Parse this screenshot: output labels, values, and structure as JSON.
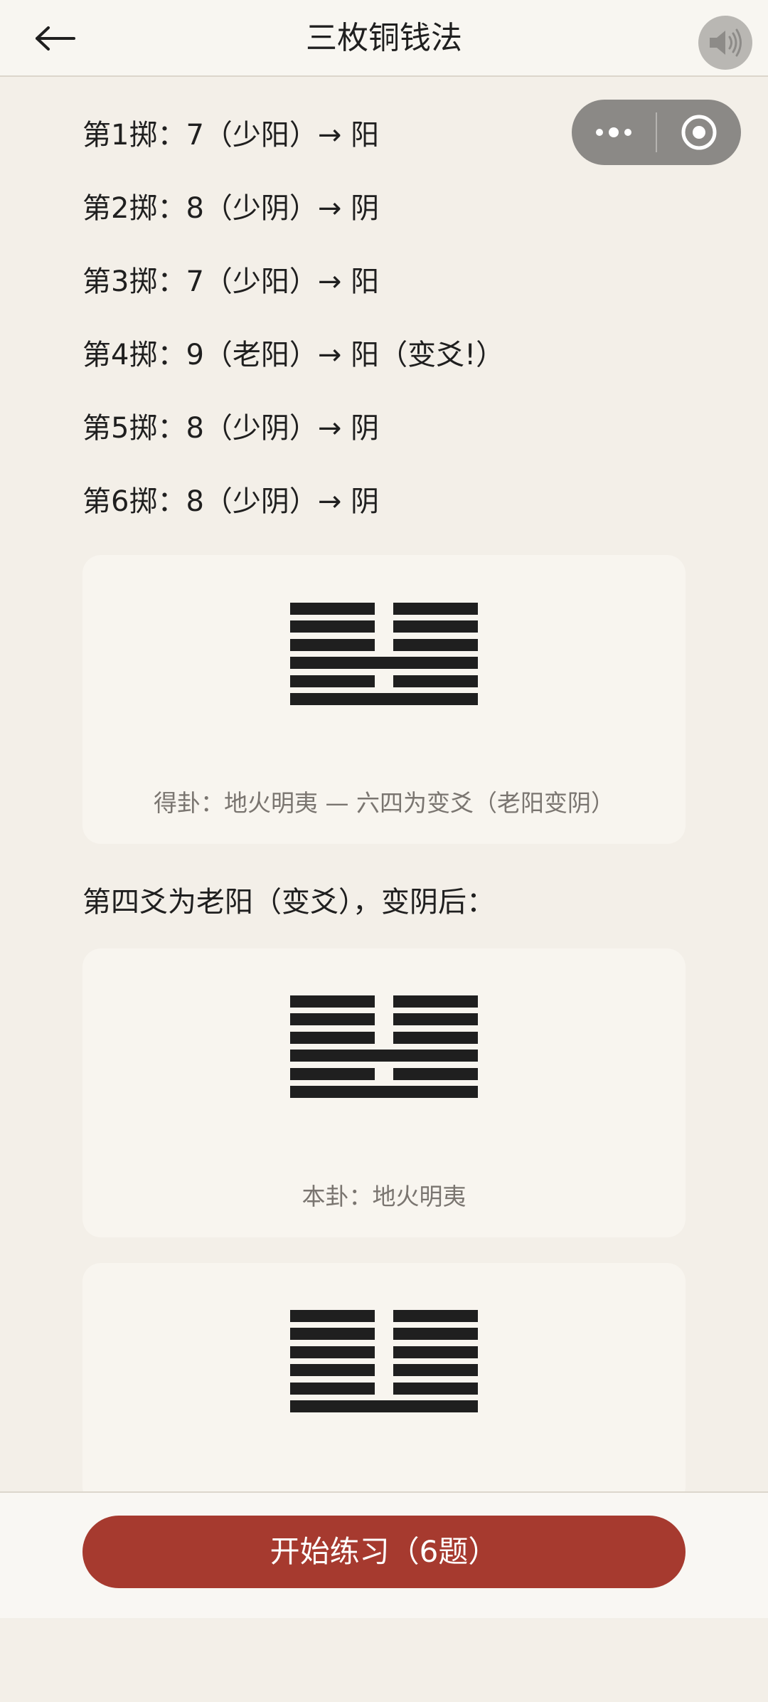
{
  "header": {
    "title": "三枚铜钱法",
    "back_icon": "arrow-left-icon",
    "sound_icon": "speaker-icon"
  },
  "capsule": {
    "more_icon": "more-dots-icon",
    "close_icon": "target-circle-icon"
  },
  "throws": [
    "第1掷：7（少阳）→ 阳",
    "第2掷：8（少阴）→ 阴",
    "第3掷：7（少阳）→ 阳",
    "第4掷：9（老阳）→ 阳（变爻!）",
    "第5掷：8（少阴）→ 阴",
    "第6掷：8（少阴）→ 阴"
  ],
  "cards": [
    {
      "caption": "得卦：地火明夷 — 六四为变爻（老阳变阴）",
      "lines_top_to_bottom": [
        "yin",
        "yin",
        "yin",
        "yang",
        "yin",
        "yang"
      ]
    },
    {
      "caption": "本卦：地火明夷",
      "lines_top_to_bottom": [
        "yin",
        "yin",
        "yin",
        "yang",
        "yin",
        "yang"
      ]
    },
    {
      "caption": "",
      "lines_top_to_bottom": [
        "yin",
        "yin",
        "yin",
        "yin",
        "yin",
        "yang"
      ]
    }
  ],
  "section_text": "第四爻为老阳（变爻），变阴后：",
  "bottom": {
    "button_label": "开始练习（6题）"
  },
  "colors": {
    "accent": "#a63a2f",
    "background": "#f3efe8",
    "card": "#f8f5ef",
    "line": "#1f1f1f"
  }
}
